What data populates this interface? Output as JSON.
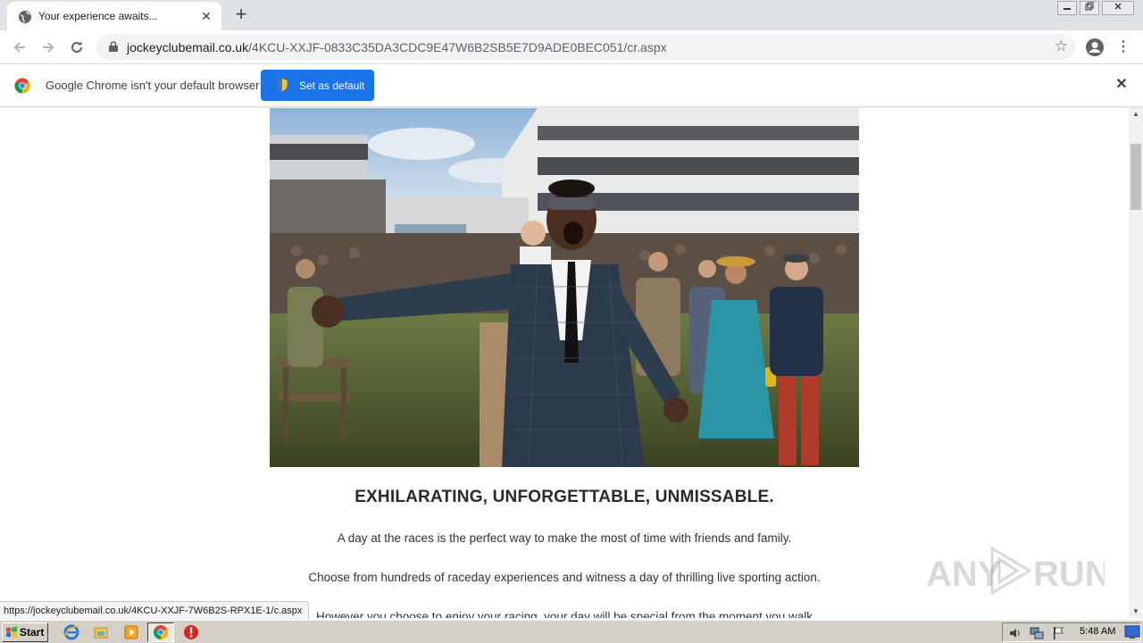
{
  "browser": {
    "tab_title": "Your experience awaits...",
    "new_tab_symbol": "+",
    "close_symbol": "✕",
    "url_domain": "jockeyclubemail.co.uk",
    "url_path": "/4KCU-XXJF-0833C35DA3CDC9E47W6B2SB5E7D9ADE0BEC051/cr.aspx",
    "infobar_message": "Google Chrome isn't your default browser",
    "set_default_label": "Set as default",
    "status_url": "https://jockeyclubemail.co.uk/4KCU-XXJF-7W6B2S-RPX1E-1/c.aspx"
  },
  "icons": {
    "back": "arrow-left-icon",
    "forward": "arrow-right-icon",
    "reload": "reload-icon",
    "lock": "lock-icon",
    "bookmark": "star-icon",
    "profile": "account-circle-icon",
    "menu": "kebab-menu-icon"
  },
  "page": {
    "hero_alt": "",
    "headline": "EXHILARATING, UNFORGETTABLE, UNMISSABLE.",
    "paragraphs": [
      "A day at the races is the perfect way to make the most of time with friends and family.",
      "Choose from hundreds of raceday experiences and witness a day of thrilling live sporting action.",
      "However you choose to enjoy your racing, your day will be special from the moment you walk"
    ]
  },
  "watermark": {
    "text": "ANY RUN"
  },
  "taskbar": {
    "start_label": "Start",
    "clock": "5:48 AM"
  },
  "colors": {
    "accent_blue": "#1a73e8",
    "tab_strip": "#dee1e6",
    "taskbar": "#d4d0c8",
    "headline_text": "#2a2a2a"
  }
}
